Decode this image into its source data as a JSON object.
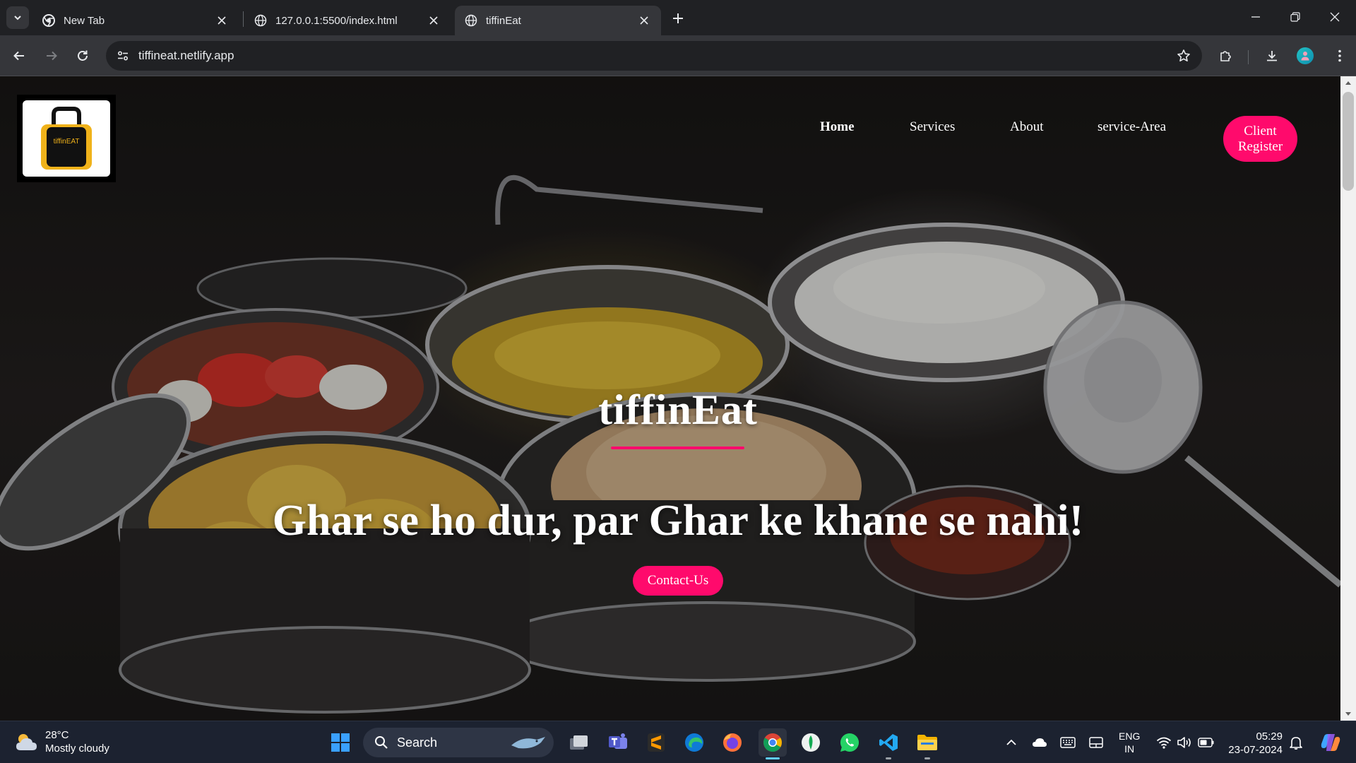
{
  "browser": {
    "tabs": [
      {
        "title": "New Tab",
        "icon": "chrome-icon"
      },
      {
        "title": "127.0.0.1:5500/index.html",
        "icon": "globe-icon"
      },
      {
        "title": "tiffinEat",
        "icon": "globe-icon",
        "active": true
      }
    ],
    "url": "tiffineat.netlify.app"
  },
  "site": {
    "logo_text": "tiffinEAT",
    "nav": [
      "Home",
      "Services",
      "About",
      "service-Area"
    ],
    "active_nav": "Home",
    "client_button": "Client Register",
    "brand": "tiffinEat",
    "tagline": "Ghar se ho dur, par Ghar ke khane se nahi!",
    "contact_button": "Contact-Us",
    "accent_color": "#ff0a6c"
  },
  "taskbar": {
    "weather": {
      "temp": "28°C",
      "condition": "Mostly cloudy"
    },
    "search_placeholder": "Search",
    "language": {
      "line1": "ENG",
      "line2": "IN"
    },
    "clock": {
      "time": "05:29",
      "date": "23-07-2024"
    }
  }
}
